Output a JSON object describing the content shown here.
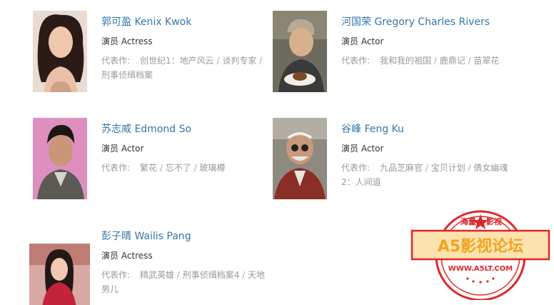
{
  "actors": [
    {
      "name": "郭可盈 Kenix Kwok",
      "role": "演员 Actress",
      "works_label": "代表作:",
      "works": [
        "创世纪1：地产风云",
        "谈判专家",
        "刑事侦缉档案"
      ]
    },
    {
      "name": "河国荣 Gregory Charles Rivers",
      "role": "演员 Actor",
      "works_label": "代表作:",
      "works": [
        "我和我的祖国",
        "鹿鼎记",
        "苗翠花"
      ]
    },
    {
      "name": "苏志威 Edmond So",
      "role": "演员 Actor",
      "works_label": "代表作:",
      "works": [
        "繁花",
        "忘不了",
        "玻璃樽"
      ]
    },
    {
      "name": "谷峰 Feng Ku",
      "role": "演员 Actor",
      "works_label": "代表作:",
      "works": [
        "九品芝麻官",
        "宝贝计划",
        "倩女幽魂2：人间道"
      ]
    },
    {
      "name": "彭子晴 Wailis Pang",
      "role": "演员 Actress",
      "works_label": "代表作:",
      "works": [
        "精武英雄",
        "刑事侦缉档案4",
        "天地男儿"
      ]
    }
  ],
  "separator": " / ",
  "watermark": {
    "top_text": "海量",
    "top_text_2": "影视",
    "main_text": "A5影视论坛",
    "url": "WWW.A5LT.COM",
    "color": "#e0262b",
    "badge_bg": "#fbe3b0",
    "badge_text_color": "#f3a320"
  }
}
